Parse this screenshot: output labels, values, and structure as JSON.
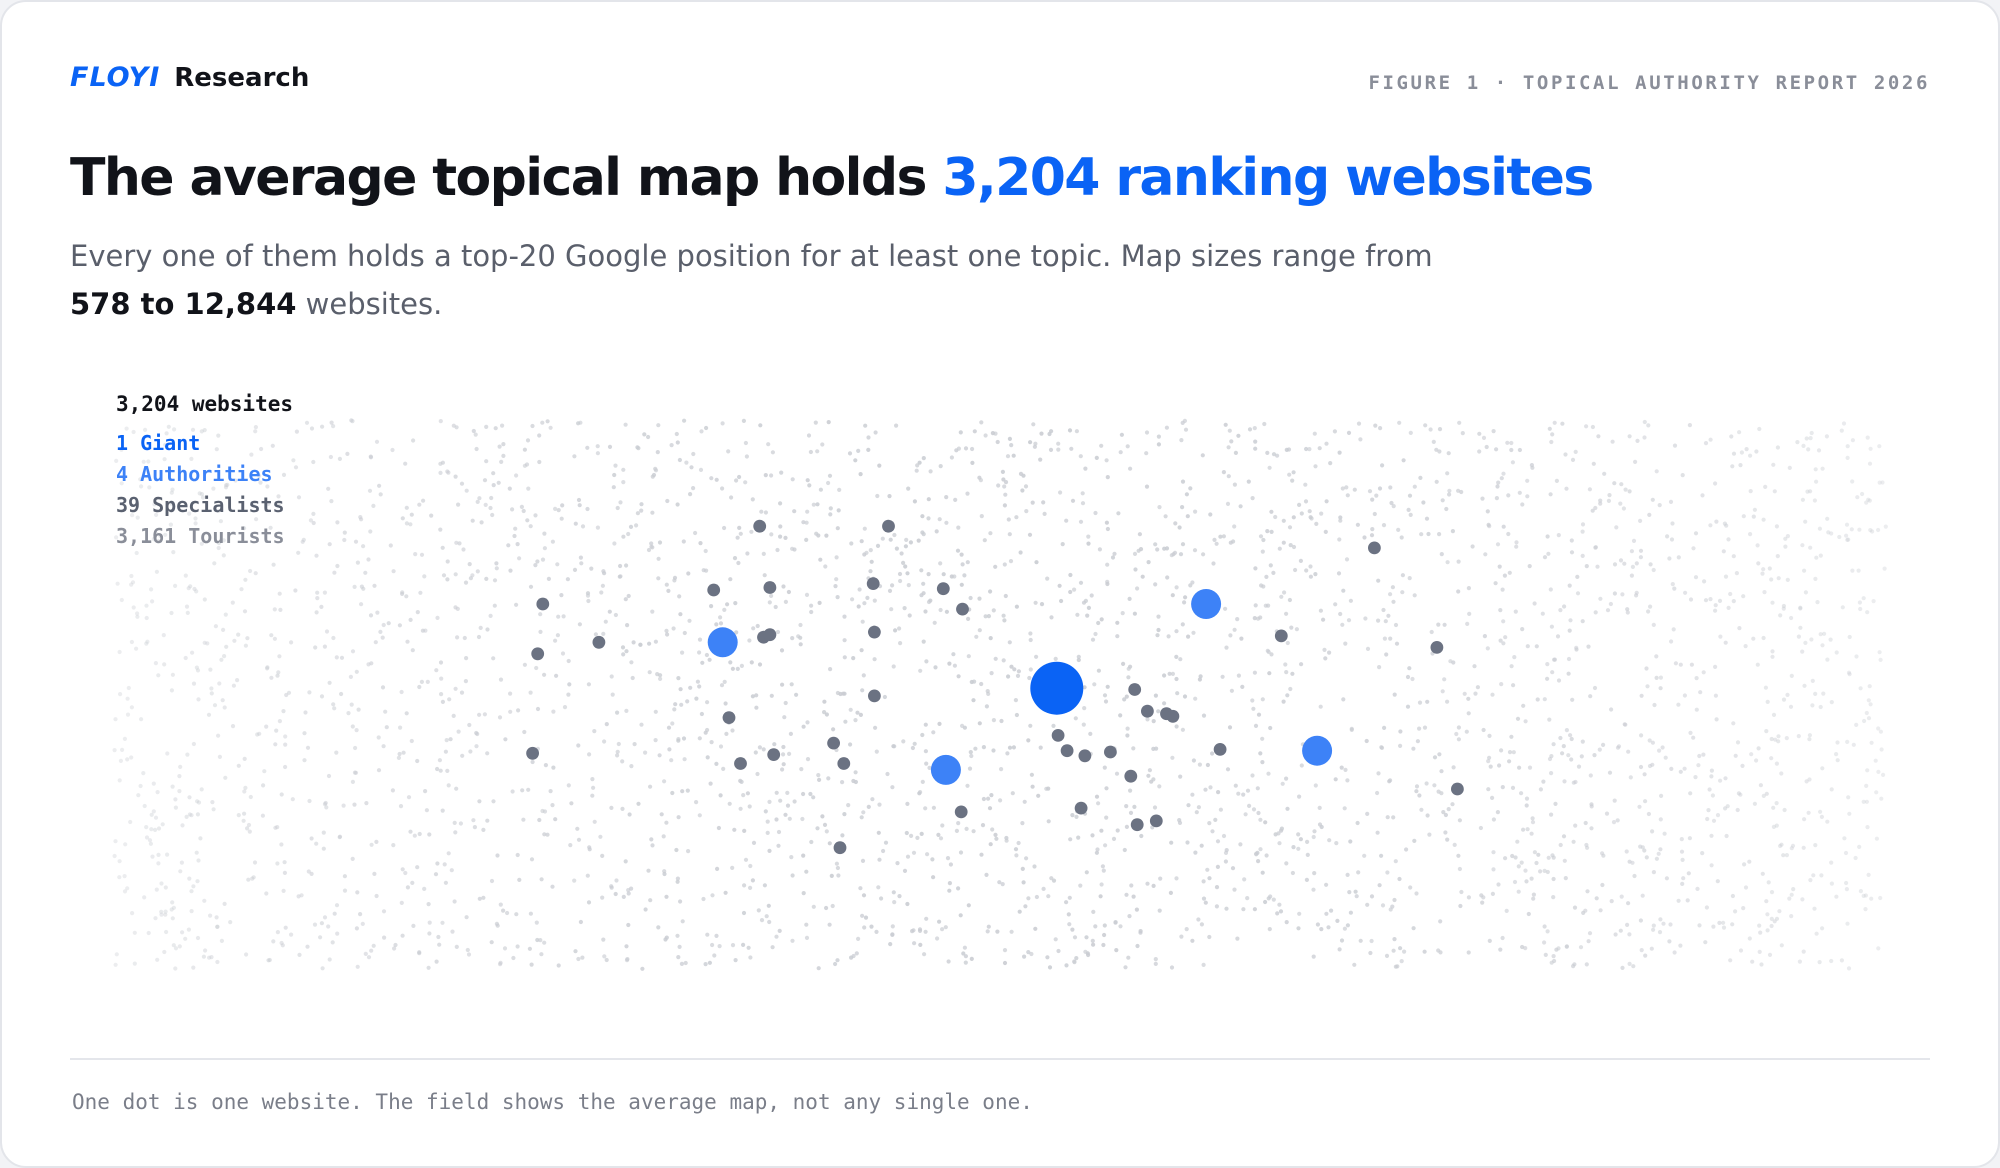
{
  "header": {
    "brand": "FLOYI",
    "brand_suffix": "Research",
    "figure_label": "FIGURE 1 · TOPICAL AUTHORITY REPORT 2026"
  },
  "title": {
    "lead": "The average topical map holds ",
    "highlight": "3,204 ranking websites"
  },
  "subtitle": {
    "text_a": "Every one of them holds a top-20 Google position for at least one topic. Map sizes range from ",
    "bold": "578 to 12,844",
    "text_b": " websites."
  },
  "legend": {
    "total": "3,204 websites",
    "giant": "1 Giant",
    "authorities": "4 Authorities",
    "specialists": "39 Specialists",
    "tourists": "3,161 Tourists"
  },
  "footnote": "One dot is one website. The field shows the average map, not any single one.",
  "colors": {
    "brand_blue": "#0a63f5",
    "giant": "#0a63f5",
    "authority": "#3d82f7",
    "specialist": "#6b7282",
    "tourist": "#c9ccd2"
  },
  "chart_data": {
    "type": "scatter",
    "description_counts": {
      "giant": 1,
      "authorities": 4,
      "specialists": 39,
      "tourists": 3161
    },
    "giant": [
      [
        827,
        538
      ]
    ],
    "authorities": [
      [
        565,
        502
      ],
      [
        944,
        472
      ],
      [
        740,
        602
      ],
      [
        1031,
        587
      ]
    ],
    "specialists": [
      [
        594,
        411
      ],
      [
        695,
        411
      ],
      [
        1076,
        428
      ],
      [
        424,
        472
      ],
      [
        558,
        461
      ],
      [
        602,
        459
      ],
      [
        683,
        456
      ],
      [
        738,
        460
      ],
      [
        753,
        476
      ],
      [
        468,
        502
      ],
      [
        420,
        511
      ],
      [
        597,
        498
      ],
      [
        602,
        496
      ],
      [
        684,
        494
      ],
      [
        1003,
        497
      ],
      [
        1125,
        506
      ],
      [
        684,
        544
      ],
      [
        888,
        539
      ],
      [
        898,
        556
      ],
      [
        913,
        558
      ],
      [
        918,
        560
      ],
      [
        570,
        561
      ],
      [
        828,
        575
      ],
      [
        652,
        581
      ],
      [
        416,
        589
      ],
      [
        579,
        597
      ],
      [
        605,
        590
      ],
      [
        660,
        597
      ],
      [
        835,
        587
      ],
      [
        849,
        591
      ],
      [
        869,
        588
      ],
      [
        955,
        586
      ],
      [
        885,
        607
      ],
      [
        1141,
        617
      ],
      [
        752,
        635
      ],
      [
        846,
        632
      ],
      [
        890,
        645
      ],
      [
        905,
        642
      ],
      [
        657,
        663
      ]
    ]
  }
}
